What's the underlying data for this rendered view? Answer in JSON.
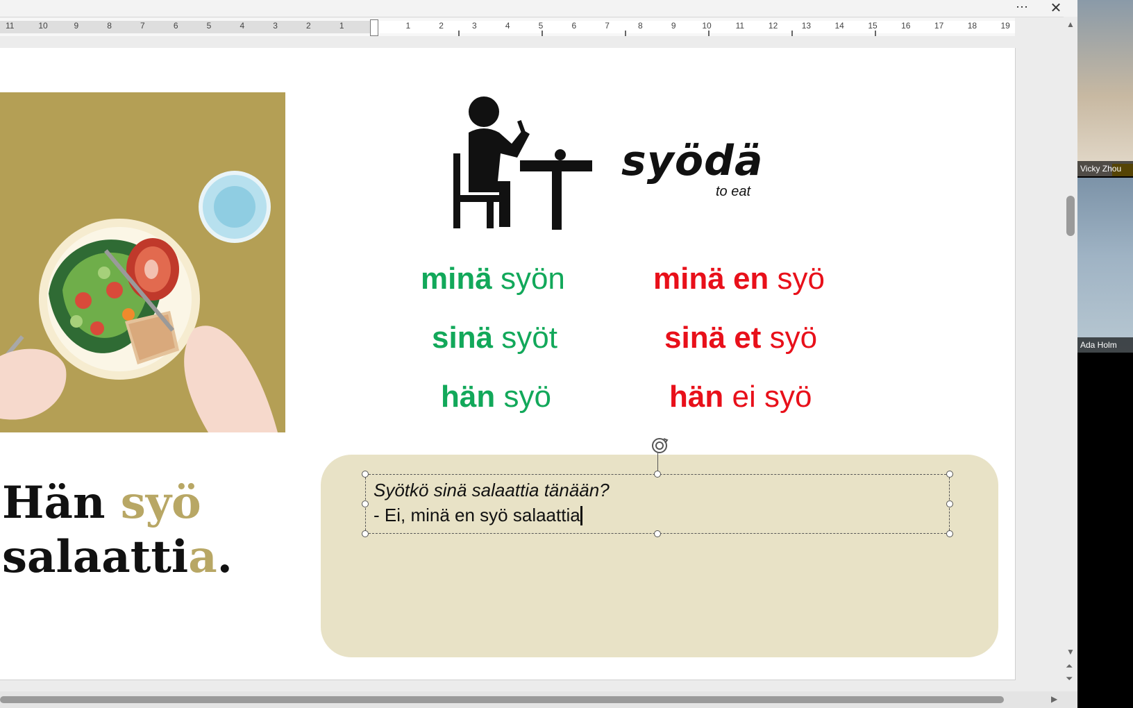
{
  "toolbar": {
    "more_icon": "⋯",
    "close_icon": "✕"
  },
  "ruler": {
    "left_ticks": [
      "11",
      "10",
      "9",
      "8",
      "7",
      "6",
      "5",
      "4",
      "3",
      "2",
      "1"
    ],
    "right_ticks": [
      "1",
      "2",
      "3",
      "4",
      "5",
      "6",
      "7",
      "8",
      "9",
      "10",
      "11",
      "12",
      "13",
      "14",
      "15",
      "16",
      "17",
      "18",
      "19"
    ]
  },
  "slide": {
    "verb": "syödä",
    "verb_translation": "to eat",
    "affirmative": [
      {
        "pronoun": "minä",
        "form": "syön"
      },
      {
        "pronoun": "sinä",
        "form": "syöt"
      },
      {
        "pronoun": "hän",
        "form": "syö"
      }
    ],
    "negative": [
      {
        "pronoun": "minä",
        "neg": "en",
        "form": "syö"
      },
      {
        "pronoun": "sinä",
        "neg": "et",
        "form": "syö"
      },
      {
        "pronoun": "hän",
        "neg": "ei",
        "form": "syö"
      }
    ],
    "big_sentence": {
      "w1": "Hän",
      "w2": "syö",
      "w3_stem": "salaatti",
      "w3_ending": "a",
      "period": "."
    },
    "textbox": {
      "line1": "Syötkö sinä salaattia tänään?",
      "line2": "- Ei, minä en syö salaattia"
    }
  },
  "scrollbars": {
    "up_icon": "▲",
    "down_icon": "▼",
    "page_up_icon": "⏶",
    "page_down_icon": "⏷",
    "right_icon": "▶"
  },
  "participants": [
    {
      "name": "Vicky Zhou"
    },
    {
      "name": "Ada Holm"
    }
  ],
  "colors": {
    "affirmative": "#12a85a",
    "negative": "#e8101a",
    "olive": "#b8a765",
    "shape_fill": "#e8e2c6",
    "image_bg": "#b49f55"
  }
}
